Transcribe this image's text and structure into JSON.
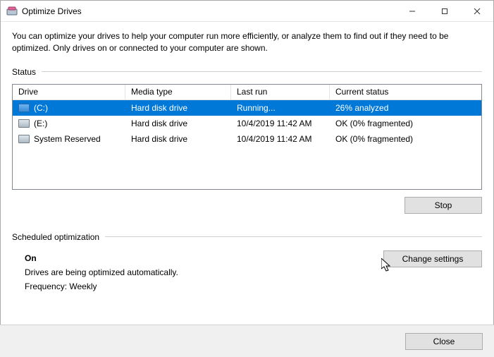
{
  "window": {
    "title": "Optimize Drives"
  },
  "intro": "You can optimize your drives to help your computer run more efficiently, or analyze them to find out if they need to be optimized. Only drives on or connected to your computer are shown.",
  "sections": {
    "status_label": "Status",
    "sched_label": "Scheduled optimization"
  },
  "table": {
    "headers": {
      "drive": "Drive",
      "media": "Media type",
      "last": "Last run",
      "status": "Current status"
    },
    "rows": [
      {
        "drive": "(C:)",
        "media": "Hard disk drive",
        "last": "Running...",
        "status": "26% analyzed",
        "selected": true
      },
      {
        "drive": "(E:)",
        "media": "Hard disk drive",
        "last": "10/4/2019 11:42 AM",
        "status": "OK (0% fragmented)",
        "selected": false
      },
      {
        "drive": "System Reserved",
        "media": "Hard disk drive",
        "last": "10/4/2019 11:42 AM",
        "status": "OK (0% fragmented)",
        "selected": false
      }
    ]
  },
  "buttons": {
    "stop": "Stop",
    "change": "Change settings",
    "close": "Close"
  },
  "sched": {
    "on": "On",
    "desc": "Drives are being optimized automatically.",
    "freq": "Frequency: Weekly"
  }
}
